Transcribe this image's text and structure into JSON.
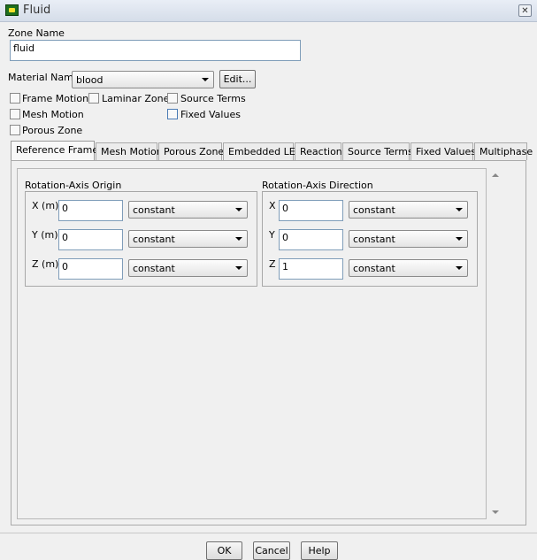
{
  "window": {
    "title": "Fluid",
    "close_symbol": "✕"
  },
  "zone": {
    "label": "Zone Name",
    "value": "fluid"
  },
  "material": {
    "label": "Material Name",
    "value": "blood",
    "edit_label": "Edit..."
  },
  "checkboxes": {
    "frame_motion": "Frame Motion",
    "laminar_zone": "Laminar Zone",
    "source_terms": "Source Terms",
    "mesh_motion": "Mesh Motion",
    "fixed_values": "Fixed Values",
    "porous_zone": "Porous Zone"
  },
  "tabs": [
    "Reference Frame",
    "Mesh Motion",
    "Porous Zone",
    "Embedded LES",
    "Reaction",
    "Source Terms",
    "Fixed Values",
    "Multiphase"
  ],
  "origin": {
    "title": "Rotation-Axis Origin",
    "x_label": "X (m)",
    "x_value": "0",
    "x_mode": "constant",
    "y_label": "Y (m)",
    "y_value": "0",
    "y_mode": "constant",
    "z_label": "Z (m)",
    "z_value": "0",
    "z_mode": "constant"
  },
  "direction": {
    "title": "Rotation-Axis Direction",
    "x_label": "X",
    "x_value": "0",
    "x_mode": "constant",
    "y_label": "Y",
    "y_value": "0",
    "y_mode": "constant",
    "z_label": "Z",
    "z_value": "1",
    "z_mode": "constant"
  },
  "footer": {
    "ok": "OK",
    "cancel": "Cancel",
    "help": "Help"
  }
}
